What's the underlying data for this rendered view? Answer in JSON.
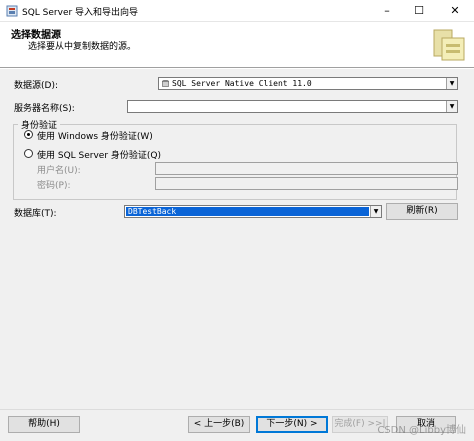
{
  "window": {
    "title": "SQL Server 导入和导出向导",
    "minimize_glyph": "–",
    "maximize_glyph": "☐",
    "close_glyph": "✕",
    "icon": "sql-server-app-icon"
  },
  "header": {
    "heading": "选择数据源",
    "subheading": "选择要从中复制数据的源。",
    "graphic": "wizard-folder-graphic"
  },
  "form": {
    "data_source": {
      "label": "数据源(D):",
      "value": "SQL Server Native Client 11.0",
      "icon": "data-provider-icon"
    },
    "server_name": {
      "label": "服务器名称(S):",
      "value": ""
    },
    "auth": {
      "legend": "身份验证",
      "windows_option": "使用 Windows 身份验证(W)",
      "sql_option": "使用 SQL Server 身份验证(Q)",
      "selected": "windows",
      "username_label": "用户名(U):",
      "password_label": "密码(P):",
      "username_value": "",
      "password_value": ""
    },
    "database": {
      "label": "数据库(T):",
      "value": "DBTestBack"
    },
    "refresh_label": "刷新(R)"
  },
  "footer": {
    "help_label": "帮助(H)",
    "back_label": "< 上一步(B)",
    "next_label": "下一步(N) >",
    "finish_label": "完成(F) >>|",
    "cancel_label": "取消"
  },
  "watermark": "CSDN @Libby博仙",
  "colors": {
    "selection": "#0a64d7",
    "default_button_border": "#0078d7",
    "panel": "#f0f0f0"
  }
}
